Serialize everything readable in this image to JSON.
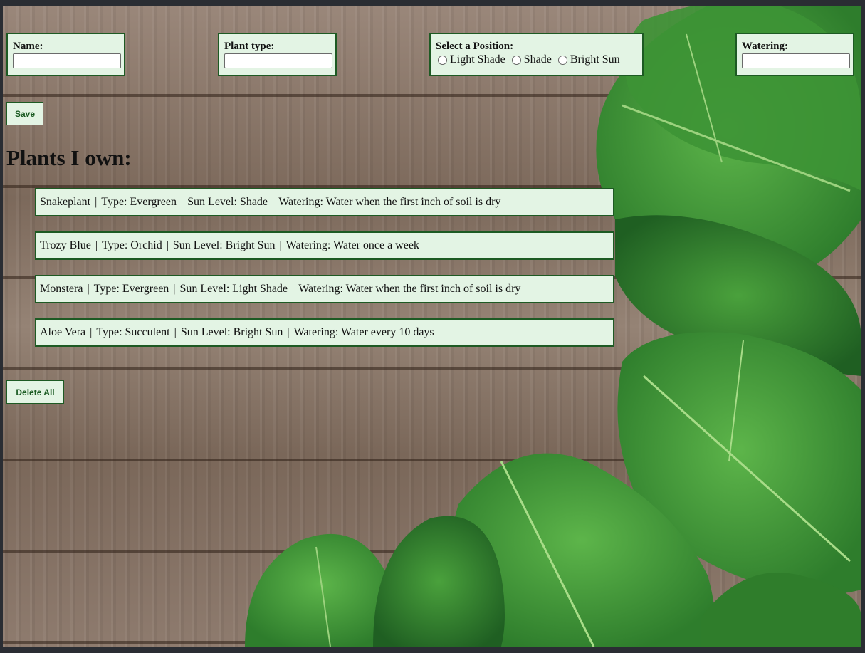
{
  "form": {
    "name": {
      "label": "Name:",
      "value": ""
    },
    "plant_type": {
      "label": "Plant type:",
      "value": ""
    },
    "position": {
      "label": "Select a Position:",
      "options": [
        "Light Shade",
        "Shade",
        "Bright Sun"
      ],
      "selected": null
    },
    "watering": {
      "label": "Watering:",
      "value": ""
    },
    "save_label": "Save"
  },
  "list": {
    "heading": "Plants I own:",
    "separator": "|",
    "items": [
      {
        "name": "Snakeplant",
        "type": "Type: Evergreen",
        "sun": "Sun Level: Shade",
        "watering": "Watering: Water when the first inch of soil is dry"
      },
      {
        "name": "Trozy Blue",
        "type": "Type: Orchid",
        "sun": "Sun Level: Bright Sun",
        "watering": "Watering: Water once a week"
      },
      {
        "name": "Monstera",
        "type": "Type: Evergreen",
        "sun": "Sun Level: Light Shade",
        "watering": "Watering: Water when the first inch of soil is dry"
      },
      {
        "name": "Aloe Vera",
        "type": "Type: Succulent",
        "sun": "Sun Level: Bright Sun",
        "watering": "Watering: Water every 10 days"
      }
    ],
    "delete_all_label": "Delete All"
  },
  "colors": {
    "panel_bg": "#e3f4e4",
    "panel_border": "#1d5a23",
    "button_text": "#1a5a22"
  }
}
